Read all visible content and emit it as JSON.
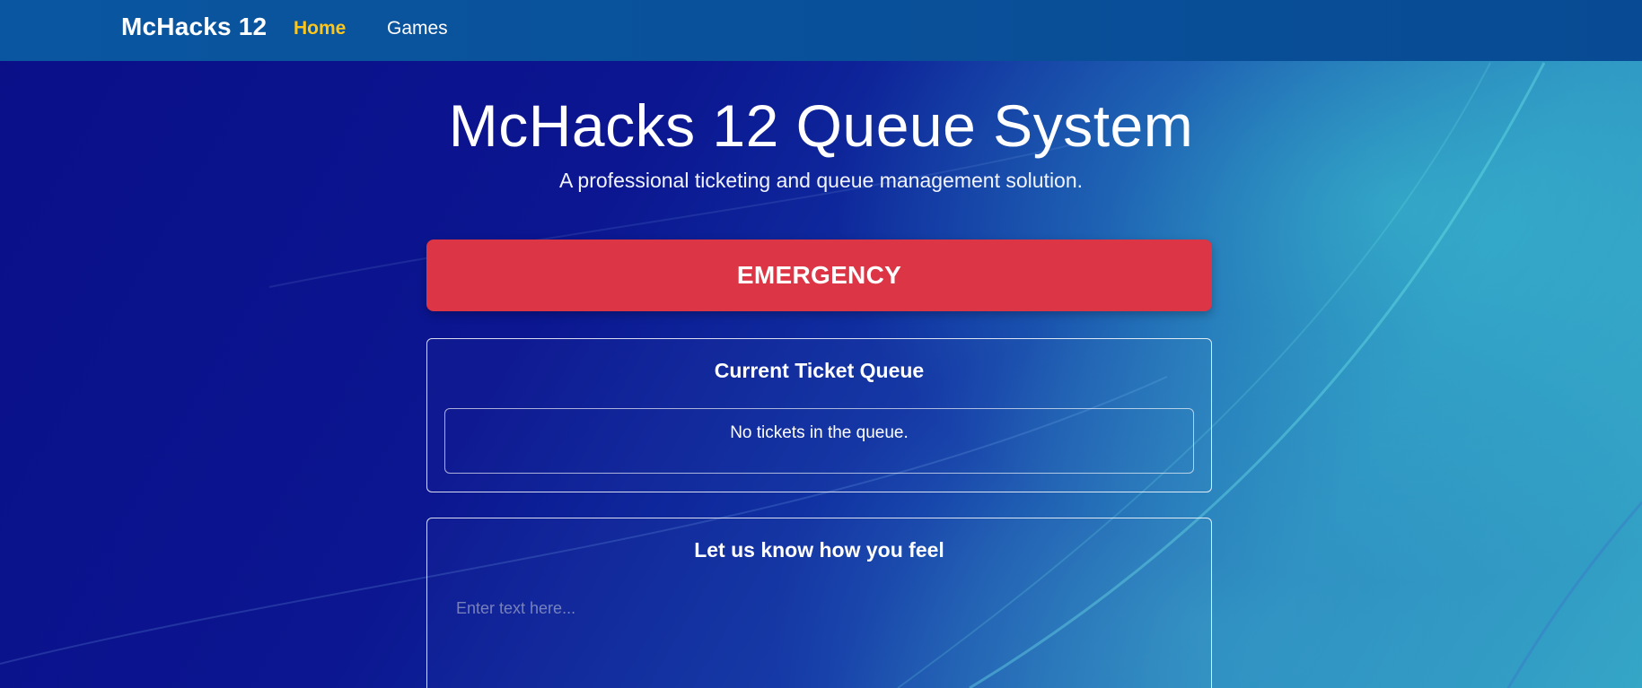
{
  "navbar": {
    "brand": "McHacks 12",
    "links": [
      {
        "label": "Home",
        "active": true
      },
      {
        "label": "Games",
        "active": false
      }
    ]
  },
  "hero": {
    "title": "McHacks 12 Queue System",
    "subtitle": "A professional ticketing and queue management solution."
  },
  "emergency": {
    "label": "EMERGENCY",
    "color": "#dc3545"
  },
  "queue": {
    "title": "Current Ticket Queue",
    "empty_message": "No tickets in the queue."
  },
  "feedback": {
    "title": "Let us know how you feel",
    "placeholder": "Enter text here...",
    "value": ""
  },
  "colors": {
    "navbar": "#0a56a0",
    "active_link": "#ffc61a",
    "background_dark": "#0a0f88",
    "background_light": "#35a6c6"
  }
}
